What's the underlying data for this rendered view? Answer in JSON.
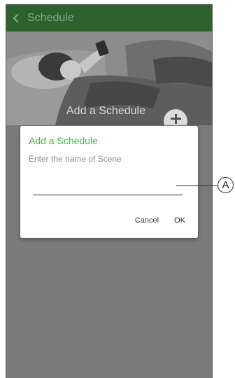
{
  "appbar": {
    "title": "Schedule",
    "back_icon": "chevron-left-icon"
  },
  "hero": {
    "label": "Add a Schedule",
    "add_icon": "plus-icon"
  },
  "dialog": {
    "title": "Add a Schedule",
    "subtitle": "Enter the name of Scene",
    "input_value": "",
    "cancel_label": "Cancel",
    "ok_label": "OK"
  },
  "callout": {
    "label": "A"
  },
  "colors": {
    "appbar": "#2c622c",
    "dialog_title": "#3dba45",
    "overlay": "#7a7a7a"
  }
}
